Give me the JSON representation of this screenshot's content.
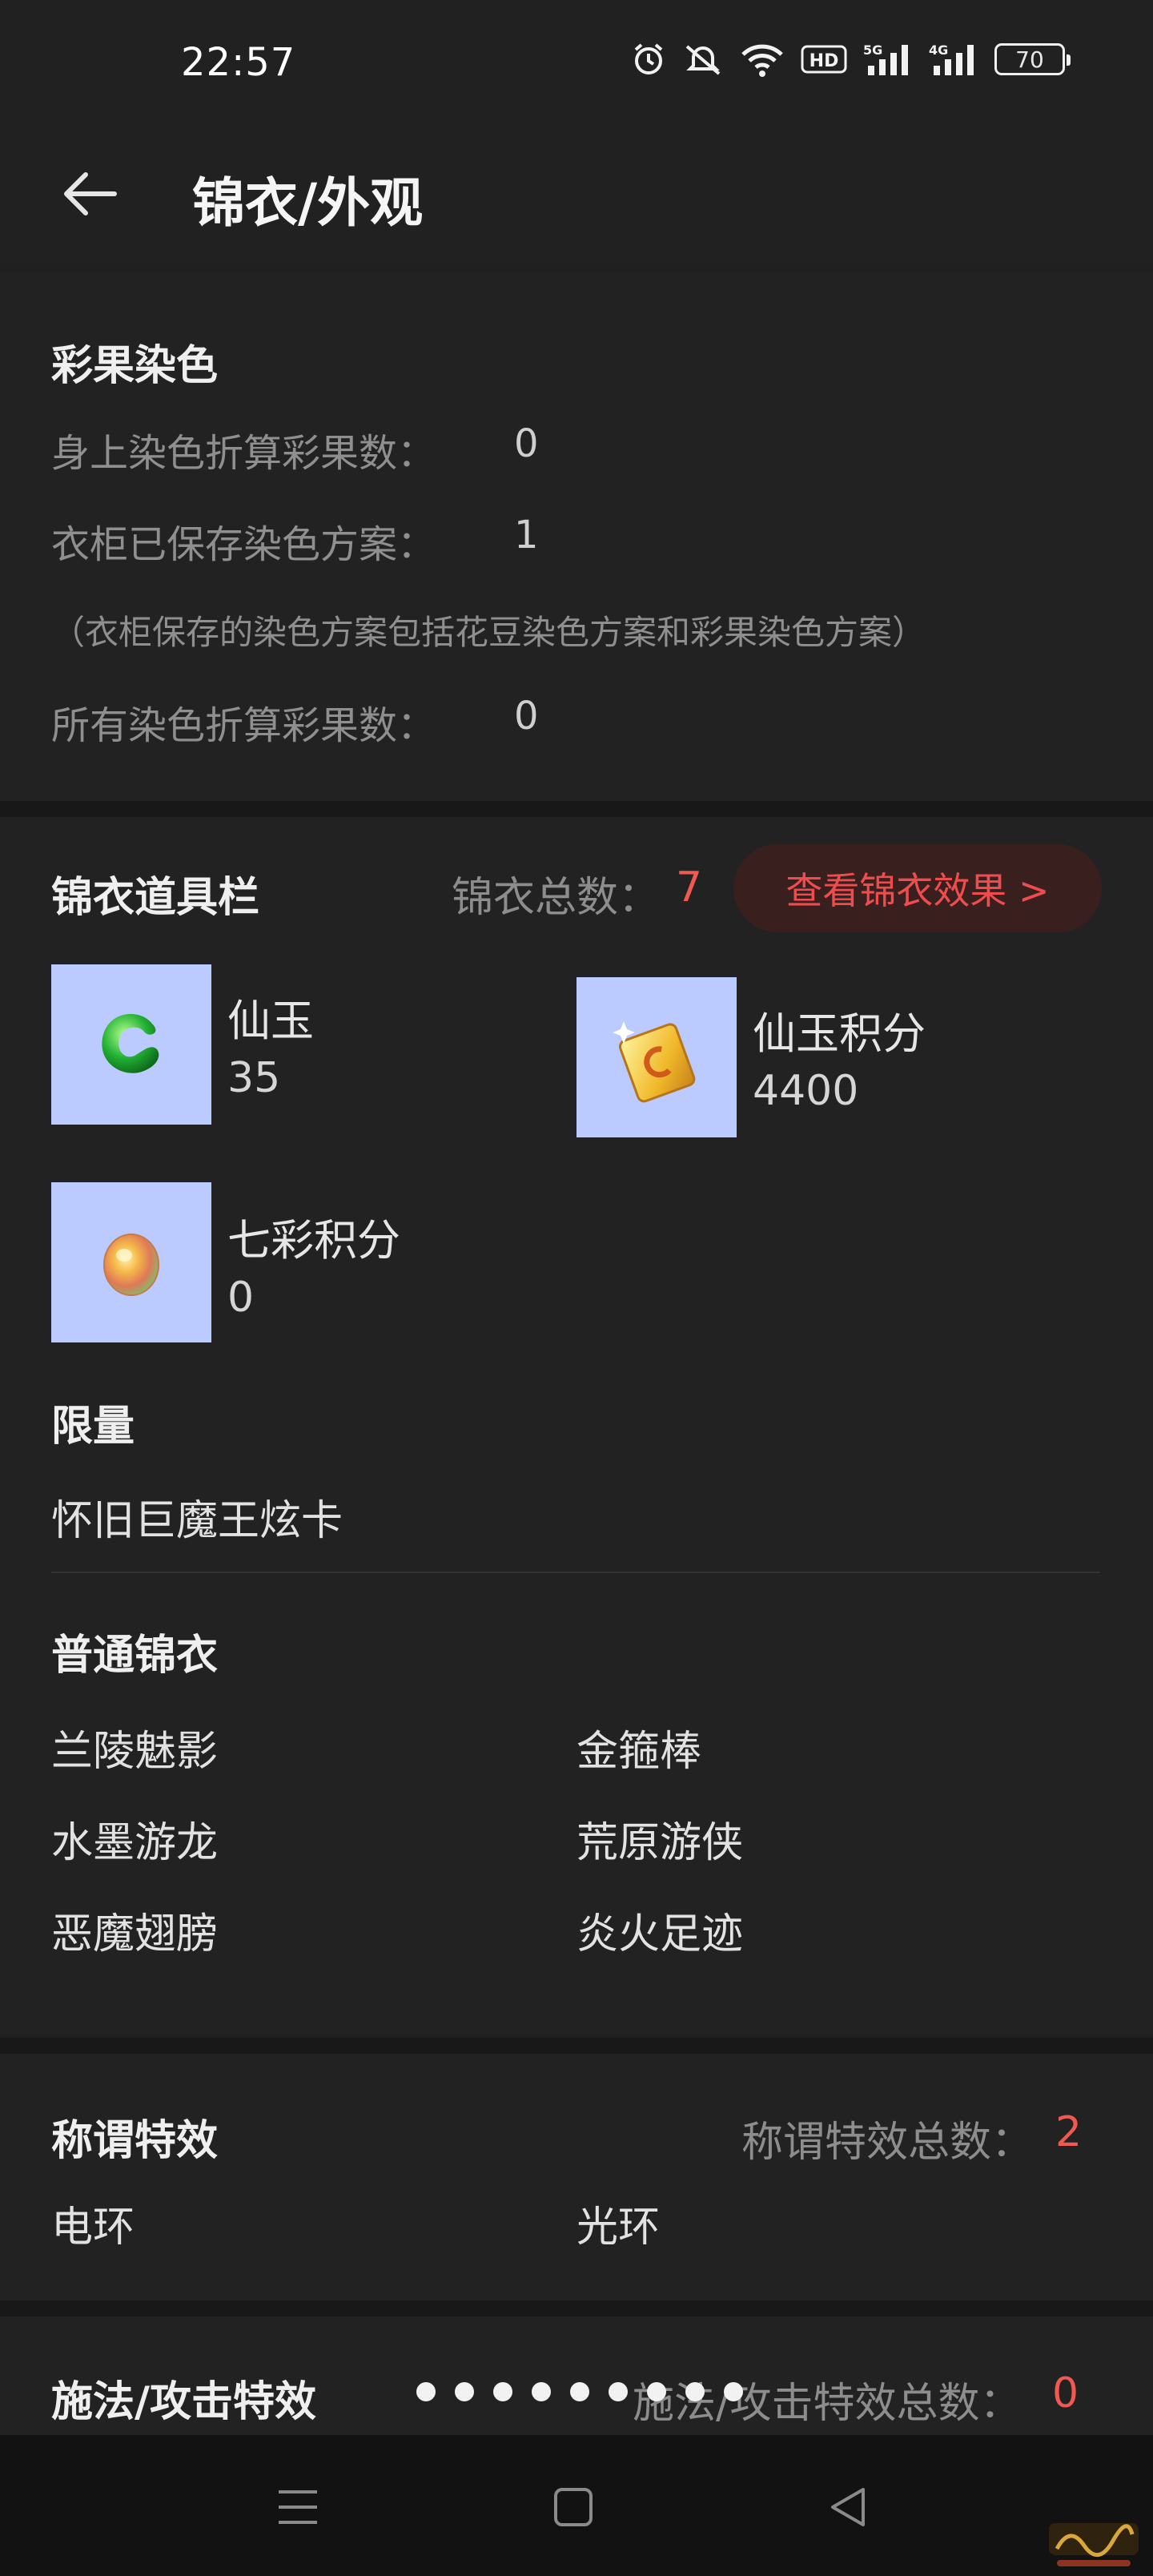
{
  "status_bar": {
    "time": "22:57",
    "battery": "70",
    "icons": [
      "alarm-icon",
      "mute-icon",
      "wifi-icon",
      "hd-icon",
      "signal-5g-icon",
      "signal-4g-icon",
      "battery-icon"
    ]
  },
  "app_bar": {
    "title": "锦衣/外观",
    "back_icon": "back-arrow-icon"
  },
  "dye": {
    "title": "彩果染色",
    "rows": [
      {
        "label": "身上染色折算彩果数：",
        "value": "0"
      },
      {
        "label": "衣柜已保存染色方案：",
        "value": "1"
      },
      {
        "label": "所有染色折算彩果数：",
        "value": "0"
      }
    ],
    "note": "（衣柜保存的染色方案包括花豆染色方案和彩果染色方案）"
  },
  "items": {
    "title": "锦衣道具栏",
    "total_label": "锦衣总数：",
    "total_value": "7",
    "view_button": "查看锦衣效果 >",
    "list": [
      {
        "name": "仙玉",
        "count": "35",
        "icon": "jade-icon"
      },
      {
        "name": "仙玉积分",
        "count": "4400",
        "icon": "jade-points-card-icon"
      },
      {
        "name": "七彩积分",
        "count": "0",
        "icon": "rainbow-points-icon"
      }
    ],
    "limited_title": "限量",
    "limited_items": [
      "怀旧巨魔王炫卡"
    ],
    "normal_title": "普通锦衣",
    "normal_items": [
      "兰陵魅影",
      "金箍棒",
      "水墨游龙",
      "荒原游侠",
      "恶魔翅膀",
      "炎火足迹"
    ]
  },
  "title_effects": {
    "title": "称谓特效",
    "total_label": "称谓特效总数：",
    "total_value": "2",
    "list": [
      "电环",
      "光环"
    ]
  },
  "cast_effects": {
    "title": "施法/攻击特效",
    "total_label": "施法/攻击特效总数：",
    "total_value": "0"
  },
  "colors": {
    "accent_red": "#ee5a52",
    "thumb_bg": "#bccbff",
    "bg": "#202020"
  }
}
